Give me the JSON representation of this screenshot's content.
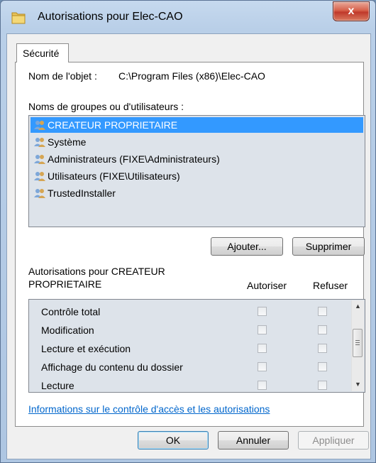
{
  "window": {
    "title": "Autorisations pour Elec-CAO",
    "close_label": "x"
  },
  "tabs": [
    {
      "label": "Sécurité"
    }
  ],
  "object": {
    "label": "Nom de l'objet :",
    "path": "C:\\Program Files (x86)\\Elec-CAO"
  },
  "groups": {
    "label": "Noms de groupes ou d'utilisateurs :",
    "items": [
      {
        "label": "CREATEUR PROPRIETAIRE",
        "selected": true
      },
      {
        "label": "Système"
      },
      {
        "label": "Administrateurs (FIXE\\Administrateurs)"
      },
      {
        "label": "Utilisateurs (FIXE\\Utilisateurs)"
      },
      {
        "label": "TrustedInstaller"
      }
    ]
  },
  "buttons": {
    "add": "Ajouter...",
    "remove": "Supprimer",
    "ok": "OK",
    "cancel": "Annuler",
    "apply": "Appliquer"
  },
  "permissions": {
    "label_line1": "Autorisations pour CREATEUR",
    "label_line2": "PROPRIETAIRE",
    "col_allow": "Autoriser",
    "col_deny": "Refuser",
    "items": [
      {
        "label": "Contrôle total",
        "allow": false,
        "deny": false
      },
      {
        "label": "Modification",
        "allow": false,
        "deny": false
      },
      {
        "label": "Lecture et exécution",
        "allow": false,
        "deny": false
      },
      {
        "label": "Affichage du contenu du dossier",
        "allow": false,
        "deny": false
      },
      {
        "label": "Lecture",
        "allow": false,
        "deny": false
      }
    ]
  },
  "link": "Informations sur le contrôle d'accès et les autorisations"
}
